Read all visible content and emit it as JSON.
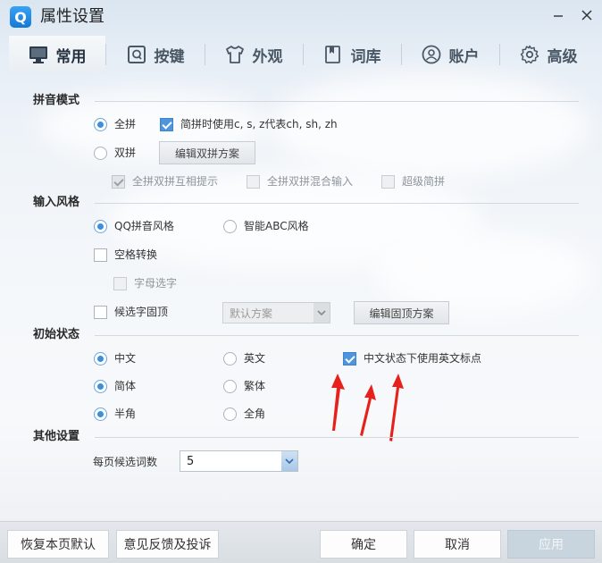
{
  "window": {
    "logo_letter": "Q",
    "title": "属性设置"
  },
  "tabs": [
    {
      "label": "常用",
      "icon": "monitor-icon",
      "active": true
    },
    {
      "label": "按键",
      "icon": "keyboard-q-icon",
      "active": false
    },
    {
      "label": "外观",
      "icon": "tshirt-icon",
      "active": false
    },
    {
      "label": "词库",
      "icon": "book-icon",
      "active": false
    },
    {
      "label": "账户",
      "icon": "user-icon",
      "active": false
    },
    {
      "label": "高级",
      "icon": "gear-icon",
      "active": false
    }
  ],
  "sections": {
    "pinyin_mode": {
      "title": "拼音模式",
      "quanpin": {
        "label": "全拼",
        "selected": true
      },
      "jianpin_check": {
        "label": "简拼时使用c, s, z代表ch, sh, zh",
        "checked": true
      },
      "shuangpin": {
        "label": "双拼",
        "selected": false
      },
      "edit_shuangpin_button": "编辑双拼方案",
      "hint_check": {
        "label": "全拼双拼互相提示",
        "checked": true,
        "disabled": true
      },
      "mixed_check": {
        "label": "全拼双拼混合输入",
        "checked": false,
        "disabled": true
      },
      "super_check": {
        "label": "超级简拼",
        "checked": false,
        "disabled": true
      }
    },
    "input_style": {
      "title": "输入风格",
      "qq_style": {
        "label": "QQ拼音风格",
        "selected": true
      },
      "abc_style": {
        "label": "智能ABC风格",
        "selected": false
      },
      "space_convert": {
        "label": "空格转换",
        "checked": false
      },
      "letter_select": {
        "label": "字母选字",
        "checked": false,
        "disabled": true
      },
      "pin_candidate": {
        "label": "候选字固顶",
        "checked": false
      },
      "scheme_select": {
        "value": "默认方案",
        "disabled": true
      },
      "edit_pin_button": "编辑固顶方案"
    },
    "initial_state": {
      "title": "初始状态",
      "chinese": {
        "label": "中文",
        "selected": true
      },
      "english": {
        "label": "英文",
        "selected": false
      },
      "english_punct": {
        "label": "中文状态下使用英文标点",
        "checked": true
      },
      "simplified": {
        "label": "简体",
        "selected": true
      },
      "traditional": {
        "label": "繁体",
        "selected": false
      },
      "half_width": {
        "label": "半角",
        "selected": true
      },
      "full_width": {
        "label": "全角",
        "selected": false
      }
    },
    "other": {
      "title": "其他设置",
      "candidates_label": "每页候选词数",
      "candidates_value": "5"
    }
  },
  "footer": {
    "restore_default": "恢复本页默认",
    "feedback": "意见反馈及投诉",
    "ok": "确定",
    "cancel": "取消",
    "apply": "应用"
  },
  "colors": {
    "accent": "#3a8fe0",
    "annotation_arrow": "#e8201b"
  }
}
